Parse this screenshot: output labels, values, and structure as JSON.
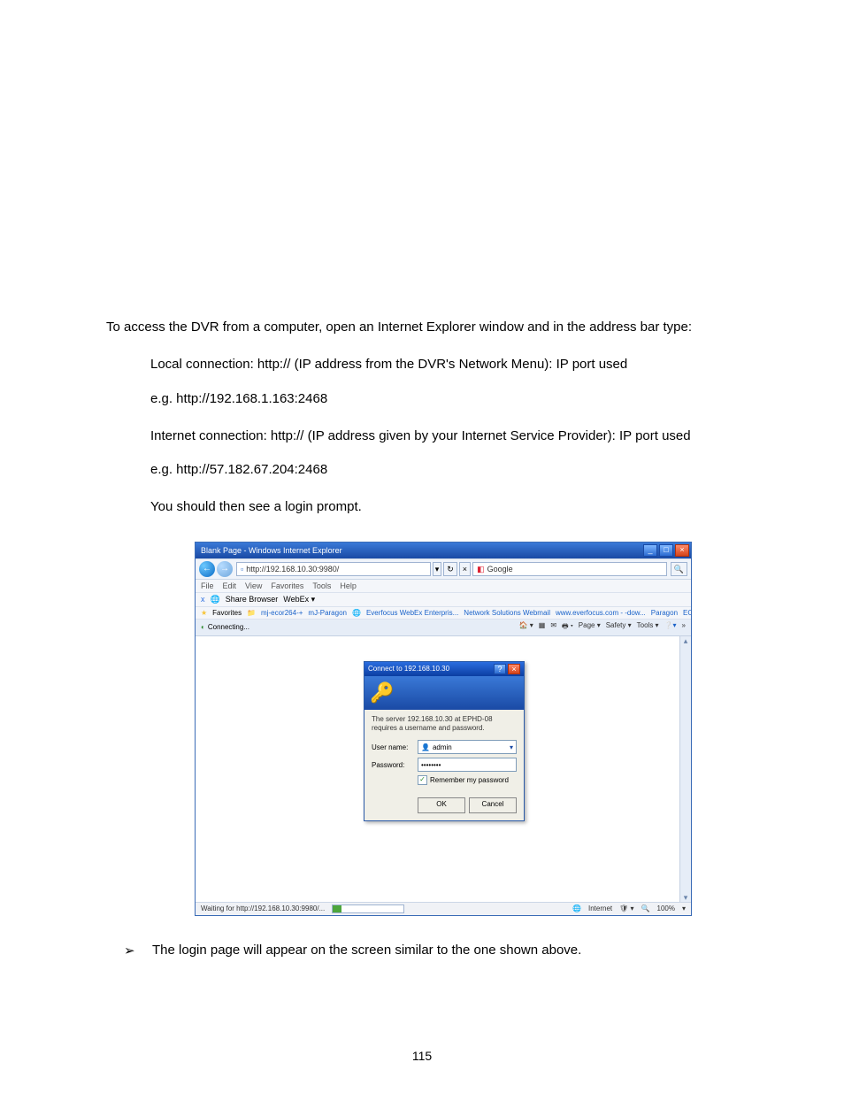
{
  "doc": {
    "p1": "To access the DVR from a computer, open an Internet Explorer window and in the address bar type:",
    "local1": "Local connection: http:// (IP address from the DVR's Network Menu): IP port used",
    "local2": "e.g. http://192.168.1.163:2468",
    "inet1": "Internet connection: http:// (IP address given by your Internet Service Provider): IP port used",
    "inet2": "e.g. http://57.182.67.204:2468",
    "prompt": "You should then see a login prompt.",
    "bullet": "The login page will appear on the screen similar to the one shown above.",
    "page_num": "115"
  },
  "browser": {
    "title": "Blank Page - Windows Internet Explorer",
    "address": "http://192.168.10.30:9980/",
    "search_placeholder": "Google",
    "menu": {
      "file": "File",
      "edit": "Edit",
      "view": "View",
      "favorites": "Favorites",
      "tools": "Tools",
      "help": "Help"
    },
    "share_row": {
      "close": "x",
      "label": "Share Browser",
      "webex": "WebEx ▾"
    },
    "fav": {
      "label": "Favorites",
      "items": [
        "mj-ecor264-+",
        "mJ-Paragon",
        "Everfocus WebEx Enterpris...",
        "Network Solutions Webmail",
        "www.everfocus.com - -dow...",
        "Paragon",
        "ECOR iConf Room"
      ]
    },
    "tab": "Connecting...",
    "toolbar": {
      "page": "Page ▾",
      "safety": "Safety ▾",
      "tools": "Tools ▾"
    },
    "status_left": "Waiting for http://192.168.10.30:9980/...",
    "status_zone": "Internet",
    "status_zoom": "100%"
  },
  "dialog": {
    "title": "Connect to 192.168.10.30",
    "msg": "The server 192.168.10.30 at EPHD-08 requires a username and password.",
    "user_label": "User name:",
    "pass_label": "Password:",
    "user_value": "admin",
    "pass_value": "••••••••",
    "remember": "Remember my password",
    "ok": "OK",
    "cancel": "Cancel"
  }
}
